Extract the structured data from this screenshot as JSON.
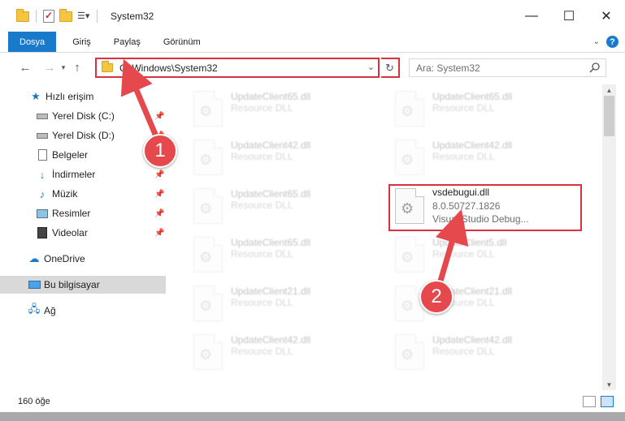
{
  "window": {
    "title": "System32",
    "minimize_glyph": "—",
    "maximize_glyph": "☐",
    "close_glyph": "✕"
  },
  "ribbon": {
    "tabs": [
      "Dosya",
      "Giriş",
      "Paylaş",
      "Görünüm"
    ],
    "help_label": "?",
    "accent_color": "#1979ca"
  },
  "navigation": {
    "address": "C:\\Windows\\System32",
    "search_placeholder": "Ara: System32"
  },
  "sidebar": {
    "items": [
      {
        "label": "Hızlı erişim",
        "icon": "star-icon",
        "pinned": false
      },
      {
        "label": "Yerel Disk (C:)",
        "icon": "drive-icon",
        "pinned": true
      },
      {
        "label": "Yerel Disk (D:)",
        "icon": "drive-icon",
        "pinned": true
      },
      {
        "label": "Belgeler",
        "icon": "documents-icon",
        "pinned": true
      },
      {
        "label": "İndirmeler",
        "icon": "download-icon",
        "pinned": true
      },
      {
        "label": "Müzik",
        "icon": "music-icon",
        "pinned": true
      },
      {
        "label": "Resimler",
        "icon": "pictures-icon",
        "pinned": true
      },
      {
        "label": "Videolar",
        "icon": "video-icon",
        "pinned": true
      },
      {
        "label": "OneDrive",
        "icon": "cloud-icon",
        "pinned": false
      },
      {
        "label": "Bu bilgisayar",
        "icon": "computer-icon",
        "pinned": false,
        "selected": true
      },
      {
        "label": "Ağ",
        "icon": "network-icon",
        "pinned": false
      }
    ]
  },
  "files": [
    {
      "name": "UpdateClient65.dll",
      "line2": "Resource DLL",
      "faded": true
    },
    {
      "name": "UpdateClient65.dll",
      "line2": "Resource DLL",
      "faded": true
    },
    {
      "name": "UpdateClient42.dll",
      "line2": "Resource DLL",
      "faded": true
    },
    {
      "name": "UpdateClient42.dll",
      "line2": "Resource DLL",
      "faded": true
    },
    {
      "name": "UpdateClient65.dll",
      "line2": "Resource DLL",
      "faded": true
    },
    {
      "name": "vsdebugui.dll",
      "line2": "8.0.50727.1826",
      "line3": "Visual Studio Debug...",
      "faded": false
    },
    {
      "name": "UpdateClient65.dll",
      "line2": "Resource DLL",
      "faded": true
    },
    {
      "name": "UpdateClient5.dll",
      "line2": "Resource DLL",
      "faded": true
    },
    {
      "name": "UpdateClient21.dll",
      "line2": "Resource DLL",
      "faded": true
    },
    {
      "name": "UpdateClient21.dll",
      "line2": "Resource DLL",
      "faded": true
    },
    {
      "name": "UpdateClient42.dll",
      "line2": "Resource DLL",
      "faded": true
    },
    {
      "name": "UpdateClient42.dll",
      "line2": "Resource DLL",
      "faded": true
    }
  ],
  "status": {
    "item_count": "160 öğe"
  },
  "annotations": {
    "badge1": "1",
    "badge2": "2",
    "highlight_color": "#d9323f"
  }
}
